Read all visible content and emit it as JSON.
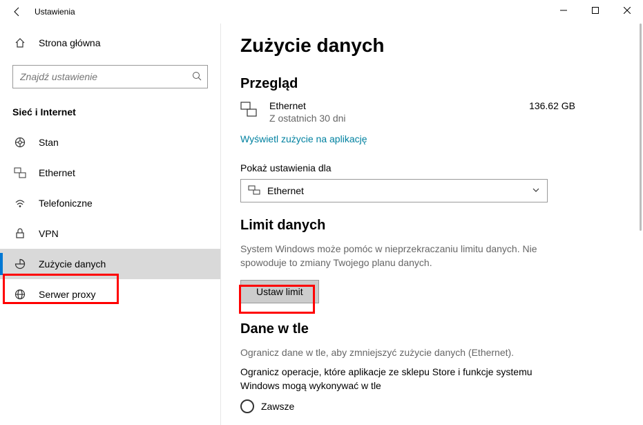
{
  "window": {
    "title": "Ustawienia"
  },
  "sidebar": {
    "home": "Strona główna",
    "searchPlaceholder": "Znajdź ustawienie",
    "category": "Sieć i Internet",
    "items": [
      {
        "label": "Stan"
      },
      {
        "label": "Ethernet"
      },
      {
        "label": "Telefoniczne"
      },
      {
        "label": "VPN"
      },
      {
        "label": "Zużycie danych"
      },
      {
        "label": "Serwer proxy"
      }
    ]
  },
  "main": {
    "title": "Zużycie danych",
    "overview": {
      "heading": "Przegląd",
      "connection": "Ethernet",
      "period": "Z ostatnich 30 dni",
      "usage": "136.62 GB",
      "link": "Wyświetl zużycie na aplikację"
    },
    "showFor": {
      "label": "Pokaż ustawienia dla",
      "value": "Ethernet"
    },
    "limit": {
      "heading": "Limit danych",
      "desc": "System Windows może pomóc w nieprzekraczaniu limitu danych. Nie spowoduje to zmiany Twojego planu danych.",
      "button": "Ustaw limit"
    },
    "background": {
      "heading": "Dane w tle",
      "desc": "Ogranicz dane w tle, aby zmniejszyć zużycie danych (Ethernet).",
      "optionDesc": "Ogranicz operacje, które aplikacje ze sklepu Store i funkcje systemu Windows mogą wykonywać w tle",
      "radio1": "Zawsze"
    }
  }
}
